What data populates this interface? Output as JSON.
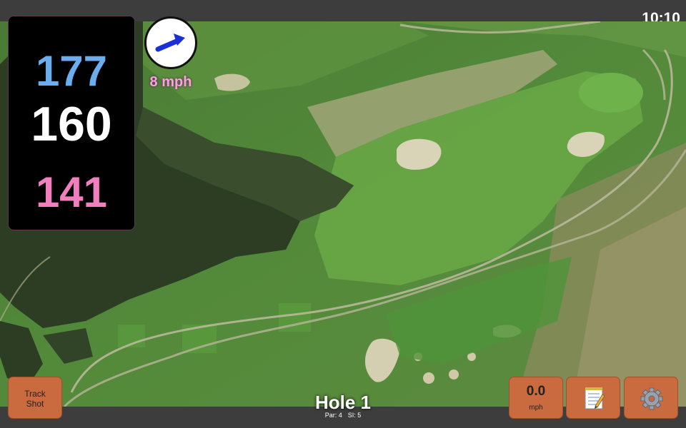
{
  "status_bar": {
    "time": "10:10"
  },
  "distances": {
    "back": "177",
    "middle": "160",
    "front": "141"
  },
  "wind": {
    "speed": "8 mph",
    "direction_icon": "arrow-icon"
  },
  "track_shot": {
    "label_line1": "Track",
    "label_line2": "Shot"
  },
  "hole": {
    "title": "Hole 1",
    "par": "Par: 4",
    "si": "SI: 5"
  },
  "speed_button": {
    "value": "0.0",
    "unit": "mph"
  },
  "notes_button": {
    "icon": "notepad-icon"
  },
  "settings_button": {
    "icon": "gear-icon"
  },
  "colors": {
    "back": "#6aaef0",
    "middle": "#ffffff",
    "front": "#f27fbd",
    "button": "#c96a3f",
    "wind_text": "#f7a3dc"
  }
}
